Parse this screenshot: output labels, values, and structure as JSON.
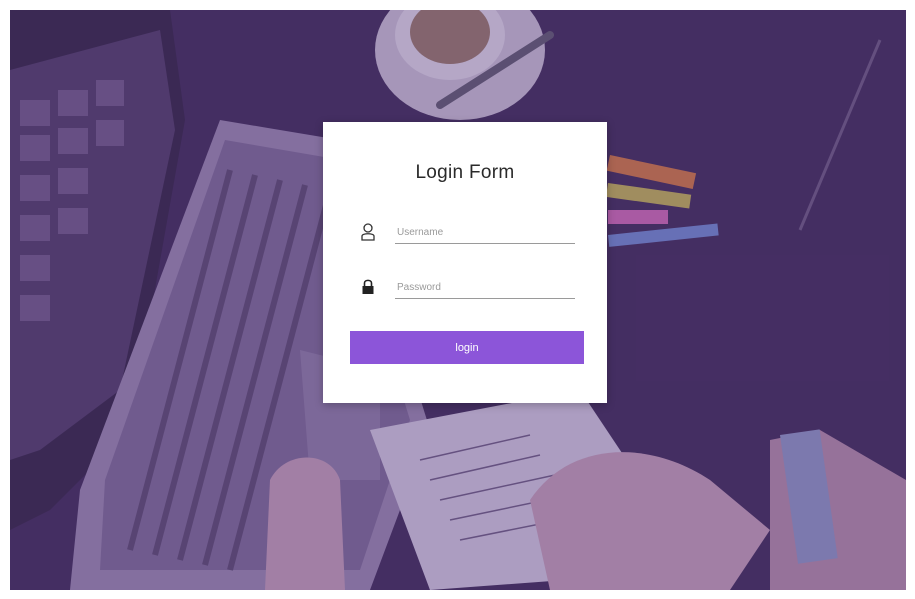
{
  "login_form": {
    "title": "Login Form",
    "username": {
      "placeholder": "Username",
      "value": "",
      "icon": "user-icon"
    },
    "password": {
      "placeholder": "Password",
      "value": "",
      "icon": "lock-icon"
    },
    "submit_label": "login"
  },
  "colors": {
    "accent": "#8c55d9",
    "overlay": "#5a3c82",
    "card": "#ffffff"
  }
}
